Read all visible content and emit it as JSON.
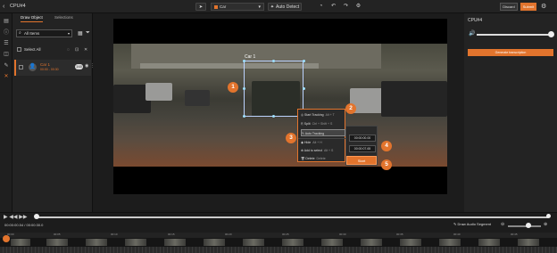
{
  "app": {
    "title": "CPU#4"
  },
  "toolbar": {
    "class_select": "Car",
    "auto_detect_label": "Auto Detect",
    "discard_label": "Discard",
    "submit_label": "Submit"
  },
  "left_panel": {
    "tabs": [
      {
        "label": "Draw Object"
      },
      {
        "label": "Selections"
      }
    ],
    "search_value": "All Items",
    "select_all_label": "Select All",
    "objects": [
      {
        "name": "Car 1",
        "time": "00:00 - 00:30",
        "count": "1/40"
      }
    ]
  },
  "canvas": {
    "bbox_label": "Car 1",
    "markers": [
      "1",
      "2",
      "3",
      "4",
      "5"
    ],
    "context_menu": [
      {
        "label": "Start Tracking",
        "kbd": "Alt + T"
      },
      {
        "label": "Split",
        "kbd": "Ctrl + Shift + S"
      },
      {
        "label": "Auto Tracking",
        "kbd": "Alt + A"
      },
      {
        "label": "Hide",
        "kbd": "Alt + H"
      },
      {
        "label": "Add to select",
        "kbd": "Alt + S"
      },
      {
        "label": "Delete",
        "kbd": "Delete"
      }
    ],
    "time_fields": [
      "00:00:00.00",
      "00:00:07.65"
    ],
    "start_label": "Start"
  },
  "right_panel": {
    "title": "CPU#4",
    "generate_label": "Generate transcription"
  },
  "timeline": {
    "current_time": "00:00:00.54",
    "total_time": "00:00:30.0",
    "audio_segment_label": "Draw Audio Segment",
    "ruler": [
      "00:00",
      "00:05",
      "00:10",
      "00:15",
      "00:20",
      "00:25",
      "00:30",
      "00:35",
      "00:40",
      "00:45"
    ]
  },
  "colors": {
    "accent": "#e2742d",
    "bbox": "#bcd3ff"
  },
  "icons": [
    "back-icon",
    "cursor-icon",
    "chevron-down-icon",
    "sparkle-icon",
    "undo-icon",
    "redo-icon",
    "gear-icon",
    "volume-icon",
    "play-icon"
  ]
}
